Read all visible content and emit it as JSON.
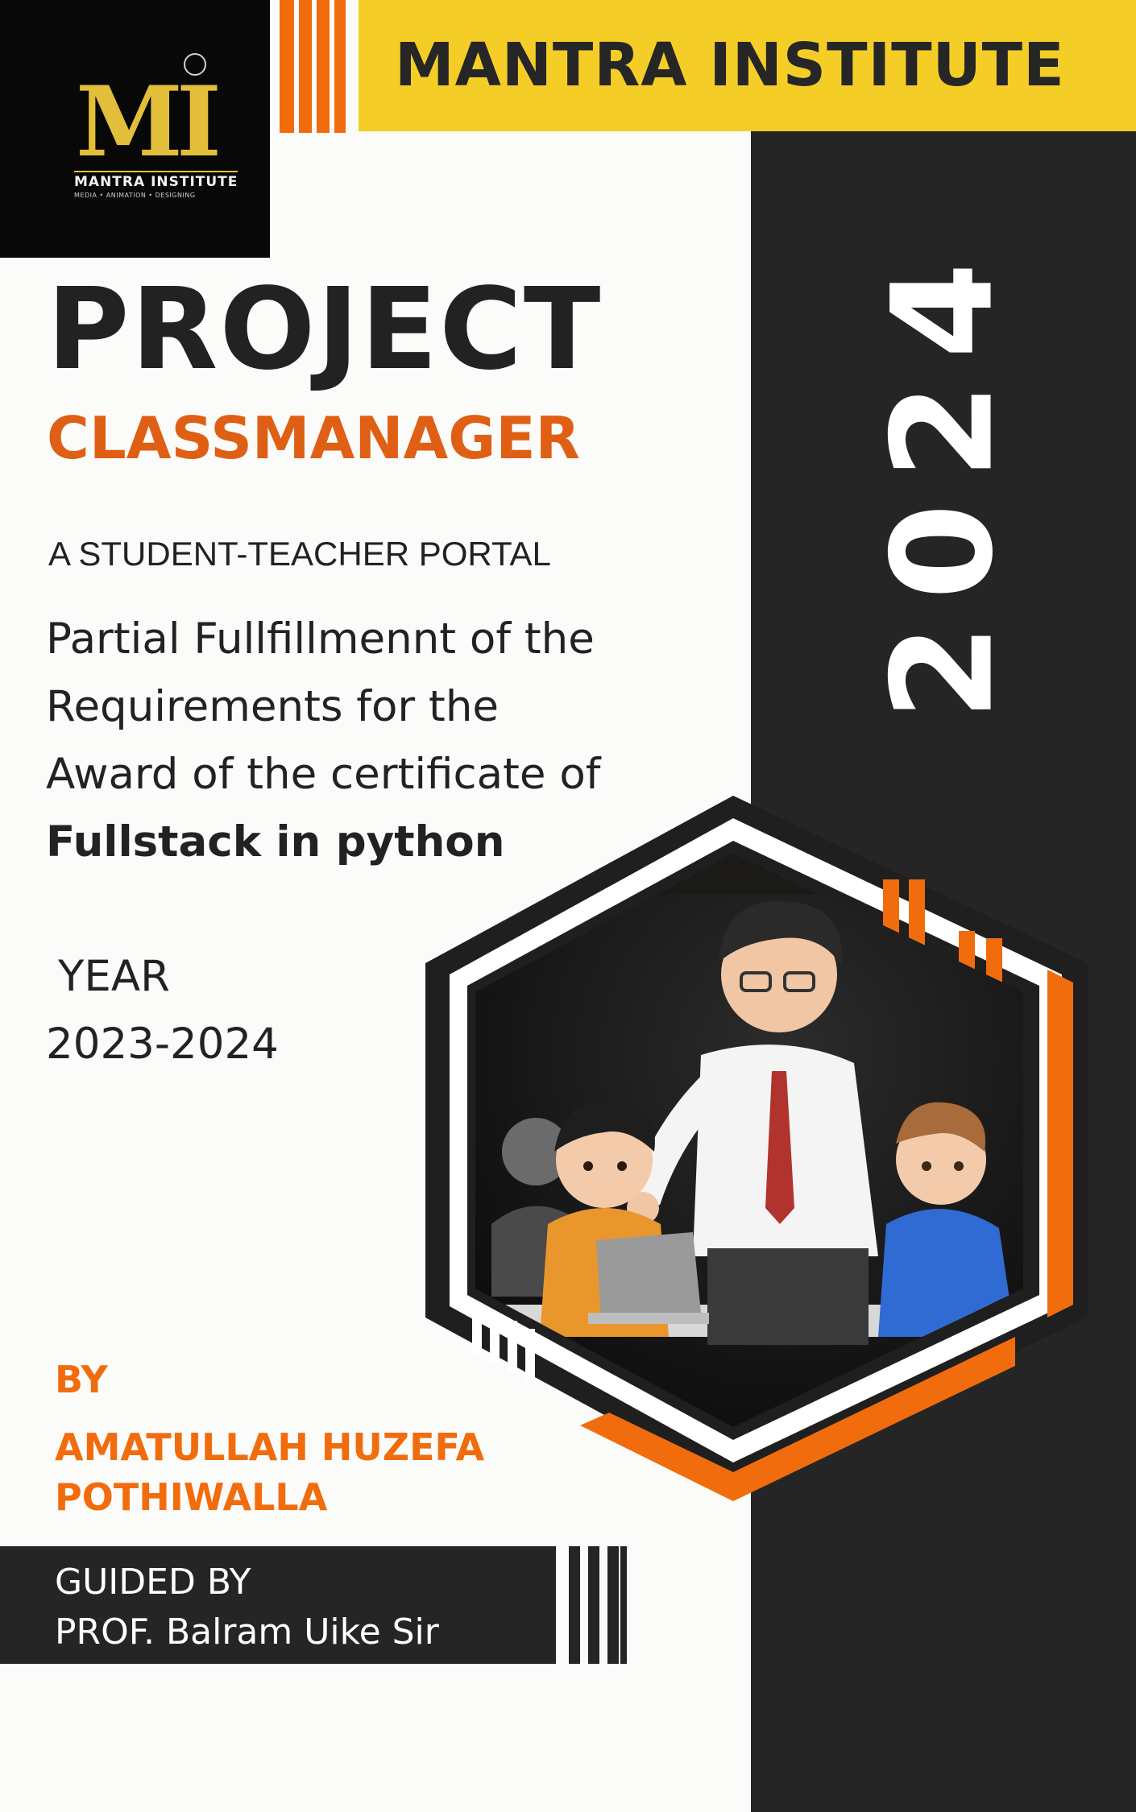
{
  "logo": {
    "monogram": "MI",
    "name": "MANTRA INSTITUTE",
    "tagline": "MEDIA • ANIMATION • DESIGNING"
  },
  "header": {
    "institute": "MANTRA INSTITUTE"
  },
  "side": {
    "year": "2024"
  },
  "project": {
    "heading": "PROJECT",
    "name": "CLASSMANAGER",
    "tagline": "A STUDENT-TEACHER PORTAL",
    "description_lines": [
      "Partial Fullfillmennt of the",
      "Requirements for the",
      "Award of the certificate  of",
      "Fullstack in python"
    ],
    "year_label": "YEAR",
    "year_range": "2023-2024"
  },
  "author": {
    "by_label": "BY",
    "name_lines": [
      "AMATULLAH HUZEFA",
      "POTHIWALLA"
    ]
  },
  "guide": {
    "label": "GUIDED BY",
    "name": "PROF. Balram Uike Sir"
  },
  "colors": {
    "banner_yellow": "#f5cd27",
    "accent_orange": "#f16c0d",
    "dark": "#252525"
  }
}
